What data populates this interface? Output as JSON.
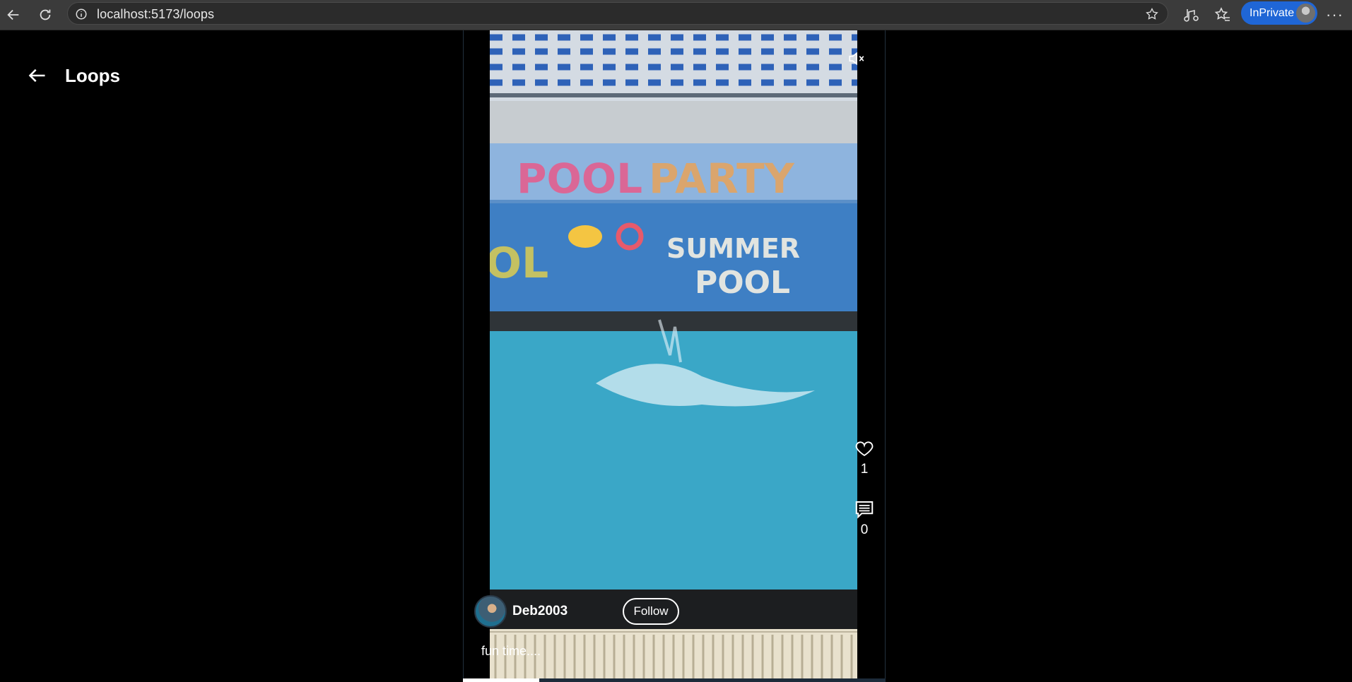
{
  "browser": {
    "url": "localhost:5173/loops",
    "inprivate_label": "InPrivate",
    "more_label": "···"
  },
  "page": {
    "title": "Loops"
  },
  "reel": {
    "author": "Deb2003",
    "follow_label": "Follow",
    "caption": "fun time....",
    "likes": "1",
    "comments": "0",
    "muted": true,
    "progress_fraction": 0.18,
    "colors": {
      "accent": "#1f66d6",
      "background": "#000000",
      "frame_border": "#22303d"
    },
    "icons": [
      "mute-icon",
      "heart-icon",
      "comment-icon",
      "back-arrow-icon"
    ]
  }
}
